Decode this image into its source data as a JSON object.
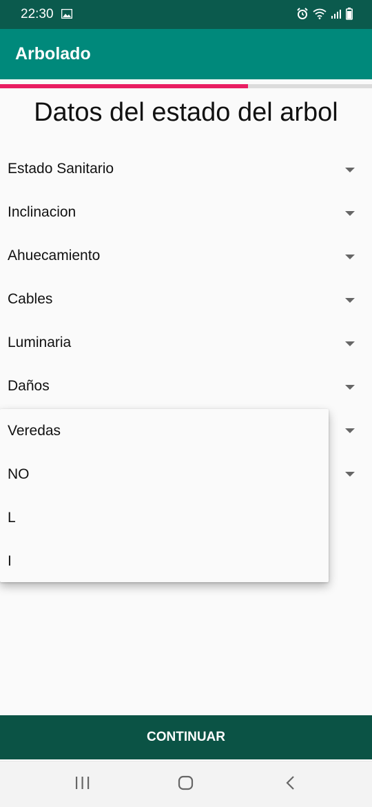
{
  "status_bar": {
    "time": "22:30",
    "icons": [
      "image-icon",
      "alarm-icon",
      "wifi-icon",
      "signal-icon",
      "battery-icon"
    ]
  },
  "app_bar": {
    "title": "Arbolado"
  },
  "progress": {
    "fraction": 0.667,
    "color": "#e91e63"
  },
  "page": {
    "title": "Datos del estado del arbol"
  },
  "fields": [
    {
      "label": "Estado Sanitario"
    },
    {
      "label": "Inclinacion"
    },
    {
      "label": "Ahuecamiento"
    },
    {
      "label": "Cables"
    },
    {
      "label": "Luminaria"
    },
    {
      "label": "Daños"
    },
    {
      "label": ""
    },
    {
      "label": ""
    }
  ],
  "dropdown": {
    "items": [
      "Veredas",
      "NO",
      "L",
      "I"
    ]
  },
  "footer": {
    "continue_label": "CONTINUAR"
  },
  "colors": {
    "status": "#0b5a4d",
    "app_bar": "#00897b",
    "button": "#0b5345",
    "accent": "#e91e63"
  },
  "nav": {
    "icons": [
      "recents-icon",
      "home-icon",
      "back-icon"
    ]
  }
}
